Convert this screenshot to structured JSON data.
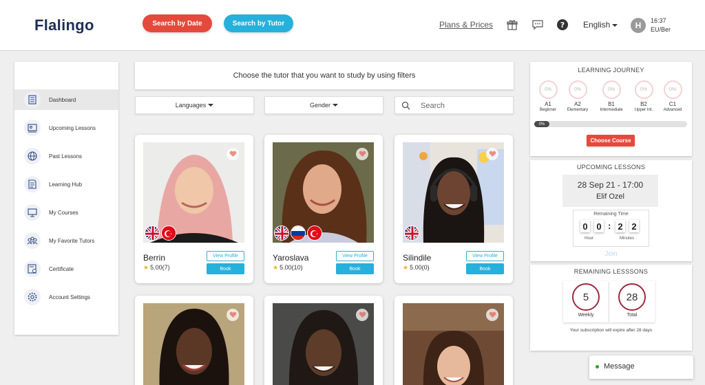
{
  "header": {
    "logo": "Flalingo",
    "search_by_date": "Search by Date",
    "search_by_tutor": "Search by Tutor",
    "plans_prices": "Plans & Prices",
    "language": "English",
    "avatar_initial": "H",
    "time": "16:37",
    "timezone": "EU/Ber"
  },
  "sidebar": {
    "items": [
      {
        "label": "Dashboard",
        "icon": "dashboard-icon"
      },
      {
        "label": "Upcoming Lessons",
        "icon": "upcoming-lessons-icon"
      },
      {
        "label": "Past Lessons",
        "icon": "past-lessons-icon"
      },
      {
        "label": "Learning Hub",
        "icon": "learning-hub-icon"
      },
      {
        "label": "My Courses",
        "icon": "my-courses-icon"
      },
      {
        "label": "My Favorite Tutors",
        "icon": "favorite-tutors-icon"
      },
      {
        "label": "Certificate",
        "icon": "certificate-icon"
      },
      {
        "label": "Account Settings",
        "icon": "settings-icon"
      }
    ]
  },
  "main": {
    "banner": "Choose the tutor that you want to study by using filters",
    "filters": {
      "languages": "Languages",
      "gender": "Gender",
      "search_placeholder": "Search"
    },
    "view_profile_label": "View Profile",
    "book_label": "Book",
    "tutors": [
      {
        "name": "Berrin",
        "rating": "5.00(7)",
        "flags": [
          "uk",
          "turkey"
        ]
      },
      {
        "name": "Yaroslava",
        "rating": "5.00(10)",
        "flags": [
          "uk",
          "russia",
          "turkey"
        ]
      },
      {
        "name": "Silindile",
        "rating": "5.00(0)",
        "flags": [
          "uk"
        ]
      }
    ]
  },
  "learning_journey": {
    "title": "LEARNING JOURNEY",
    "levels": [
      {
        "pct": "0%",
        "code": "A1",
        "name": "Beginner"
      },
      {
        "pct": "0%",
        "code": "A2",
        "name": "Elementary"
      },
      {
        "pct": "0%",
        "code": "B1",
        "name": "Intermediate"
      },
      {
        "pct": "0%",
        "code": "B2",
        "name": "Upper Int."
      },
      {
        "pct": "0%",
        "code": "C1",
        "name": "Advanced"
      }
    ],
    "progress": "0%",
    "choose_course": "Choose Course"
  },
  "upcoming": {
    "title": "UPCOMING LESSONS",
    "date": "28 Sep 21 - 17:00",
    "tutor": "Elif Ozel",
    "remaining_label": "Remaining Time",
    "digits": [
      "0",
      "0",
      "2",
      "2"
    ],
    "hour_label": "Hour",
    "minutes_label": "Minutes",
    "join": "Join"
  },
  "remaining": {
    "title": "REMAINING LESSSONS",
    "weekly_value": "5",
    "weekly_label": "Weekly",
    "total_value": "28",
    "total_label": "Total",
    "note": "Your subscription will expire after 28 days"
  },
  "message": {
    "label": "Message"
  },
  "colors": {
    "brand_navy": "#1d2f57",
    "accent_red": "#e5493b",
    "accent_blue": "#26b0dc",
    "ring_maroon": "#9c2a3d"
  }
}
